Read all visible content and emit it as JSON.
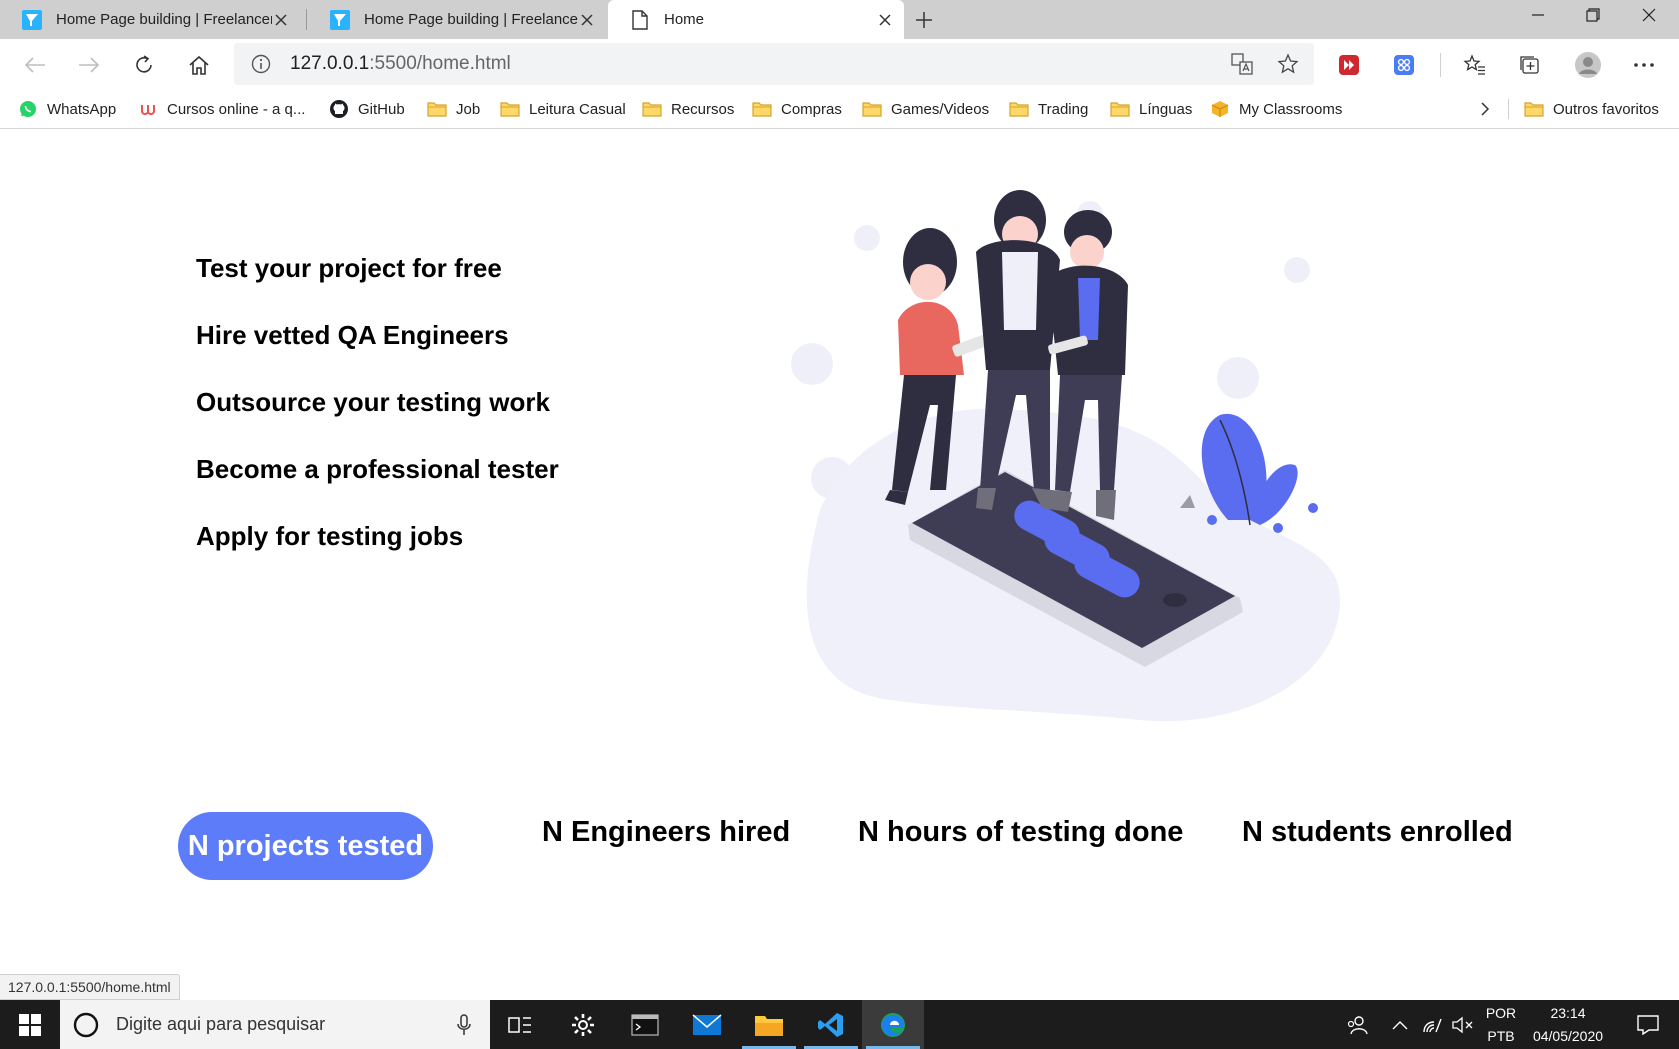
{
  "browser": {
    "tabs": [
      {
        "title": "Home Page building | Freelancer",
        "favicon": "freelancer-icon",
        "active": false
      },
      {
        "title": "Home Page building | Freelancer",
        "favicon": "freelancer-icon",
        "active": false
      },
      {
        "title": "Home",
        "favicon": "page-icon",
        "active": true
      }
    ],
    "address": {
      "host": "127.0.0.1",
      "path": ":5500/home.html"
    },
    "bookmarks": [
      {
        "label": "WhatsApp",
        "icon": "whatsapp-icon"
      },
      {
        "label": "Cursos online - a q...",
        "icon": "udemy-icon"
      },
      {
        "label": "GitHub",
        "icon": "github-icon"
      },
      {
        "label": "Job",
        "icon": "folder-icon"
      },
      {
        "label": "Leitura Casual",
        "icon": "folder-icon"
      },
      {
        "label": "Recursos",
        "icon": "folder-icon"
      },
      {
        "label": "Compras",
        "icon": "folder-icon"
      },
      {
        "label": "Games/Videos",
        "icon": "folder-icon"
      },
      {
        "label": "Trading",
        "icon": "folder-icon"
      },
      {
        "label": "Línguas",
        "icon": "folder-icon"
      },
      {
        "label": "My Classrooms",
        "icon": "box-icon"
      }
    ],
    "other_favorites": "Outros favoritos",
    "status_url": "127.0.0.1:5500/home.html"
  },
  "page": {
    "features": [
      "Test your project for free",
      "Hire vetted QA Engineers",
      "Outsource your testing work",
      "Become a professional tester",
      "Apply for testing jobs"
    ],
    "stats": [
      "N projects tested",
      "N Engineers hired",
      "N hours of testing done",
      "N students enrolled"
    ],
    "colors": {
      "accent": "#5c7cfa",
      "illustration_accent": "#5a6cf0",
      "illustration_blob": "#f0f0fb",
      "illustration_dark": "#2f2e41",
      "illustration_coral": "#e8675f"
    }
  },
  "taskbar": {
    "search_placeholder": "Digite aqui para pesquisar",
    "lang_top": "POR",
    "lang_bottom": "PTB",
    "time": "23:14",
    "date": "04/05/2020"
  }
}
